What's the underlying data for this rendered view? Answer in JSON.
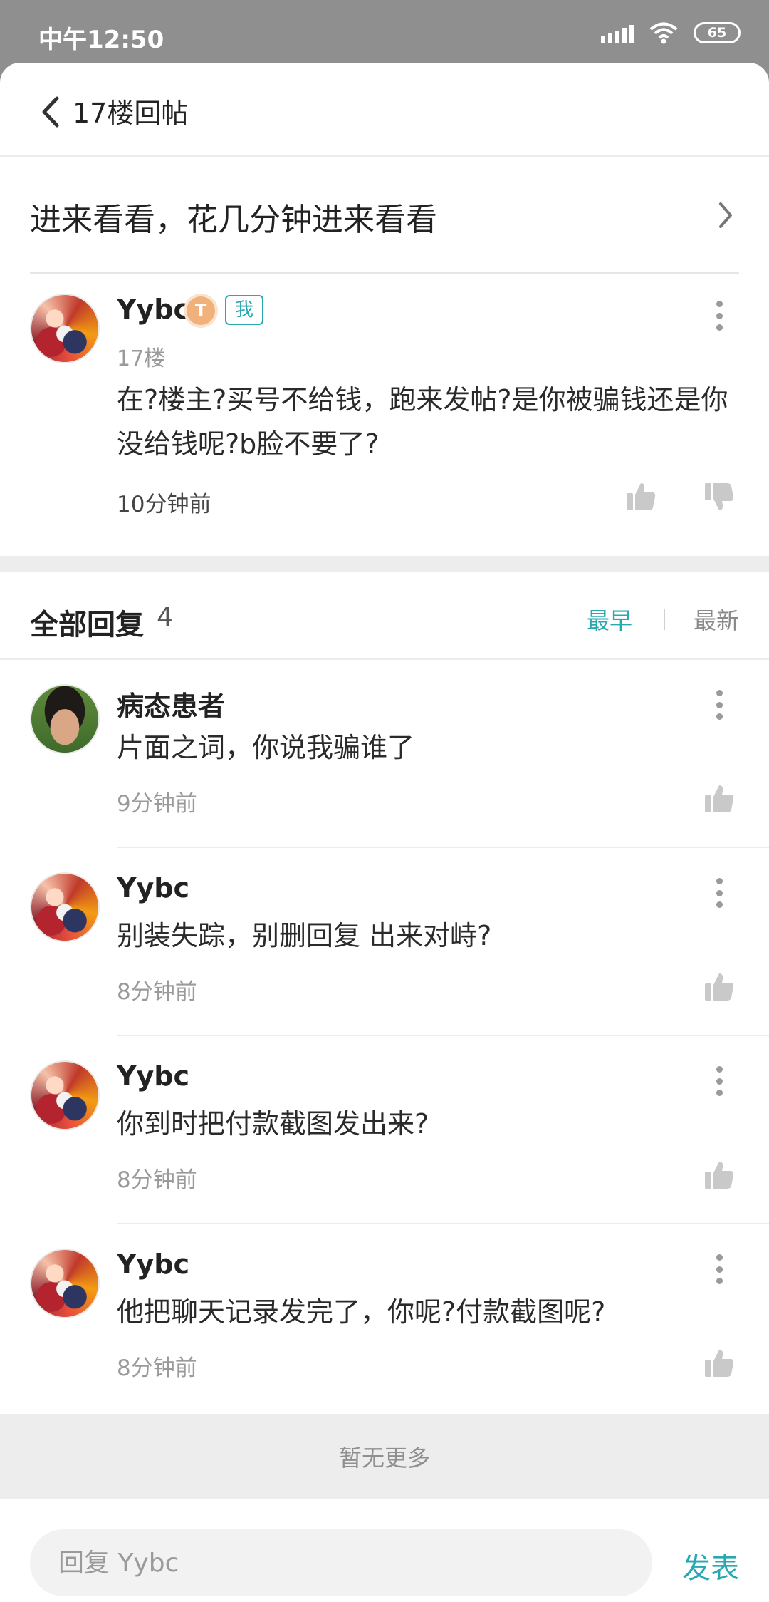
{
  "status_bar": {
    "time": "中午12:50",
    "battery": "65"
  },
  "header": {
    "title": "17楼回帖"
  },
  "thread": {
    "title": "进来看看，花几分钟进来看看"
  },
  "op_post": {
    "username": "Yybc",
    "level": "T",
    "me_tag": "我",
    "floor": "17楼",
    "body": "在?楼主?买号不给钱，跑来发帖?是你被骗钱还是你没给钱呢?b脸不要了?",
    "time": "10分钟前"
  },
  "replies_header": {
    "title": "全部回复",
    "count": "4",
    "sort_earliest": "最早",
    "sort_latest": "最新"
  },
  "replies": [
    {
      "username": "病态患者",
      "body": "片面之词，你说我骗谁了",
      "time": "9分钟前",
      "avatar": "photo"
    },
    {
      "username": "Yybc",
      "body": "别装失踪，别删回复 出来对峙?",
      "time": "8分钟前",
      "avatar": "anime"
    },
    {
      "username": "Yybc",
      "body": "你到时把付款截图发出来?",
      "time": "8分钟前",
      "avatar": "anime"
    },
    {
      "username": "Yybc",
      "body": "他把聊天记录发完了，你呢?付款截图呢?",
      "time": "8分钟前",
      "avatar": "anime"
    }
  ],
  "footer": {
    "no_more": "暂无更多"
  },
  "bottom_bar": {
    "placeholder": "回复 Yybc",
    "send": "发表"
  },
  "colors": {
    "accent": "#2aa8b2",
    "status_bar": "#8f8f8f",
    "divider": "#ededed"
  }
}
